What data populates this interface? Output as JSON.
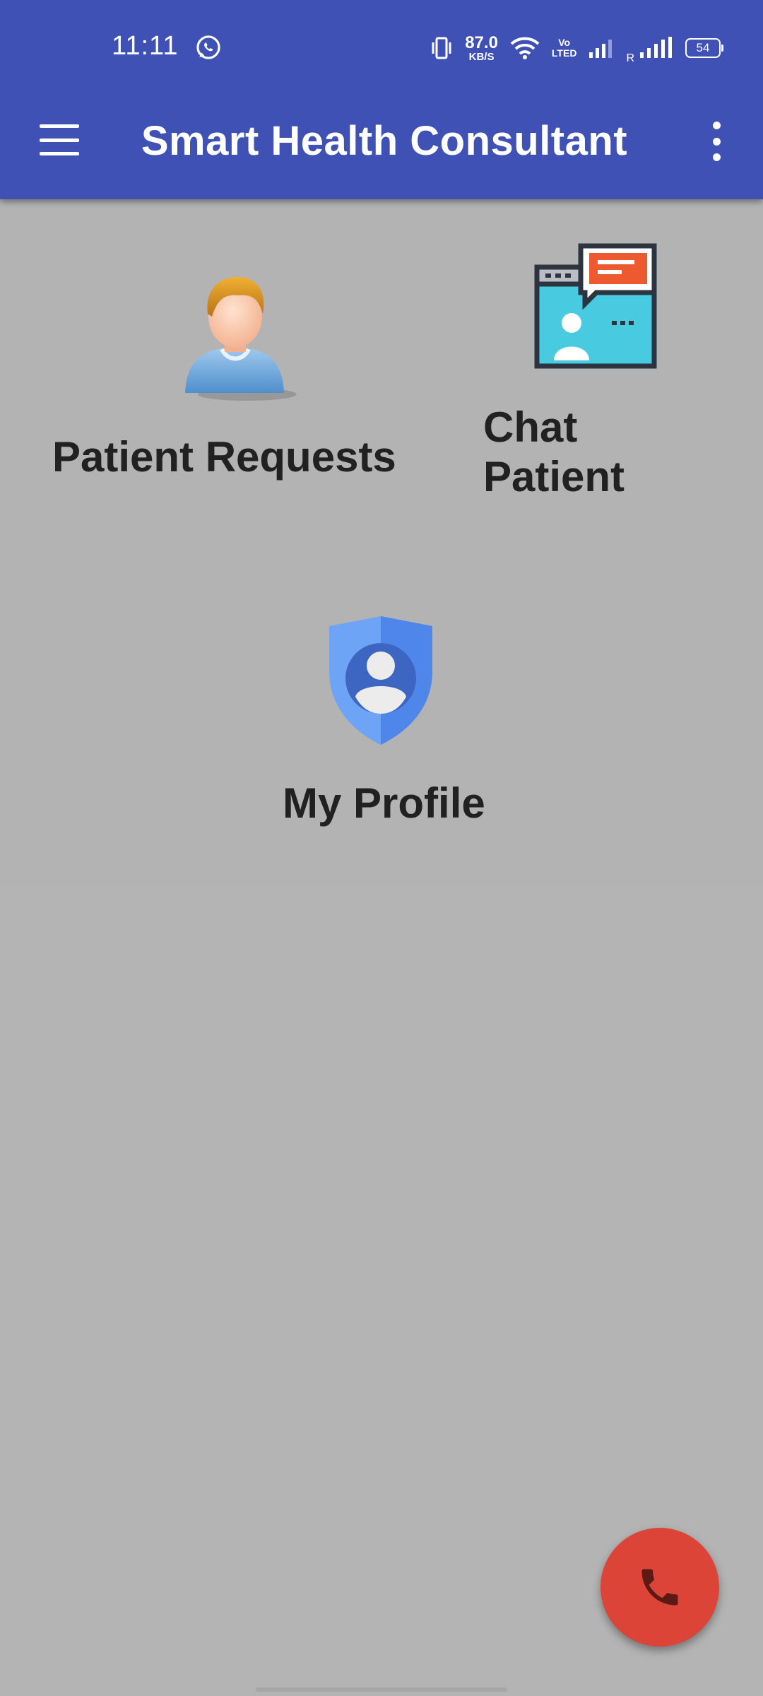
{
  "status_bar": {
    "time": "11:11",
    "network_speed_value": "87.0",
    "network_speed_unit": "KB/S",
    "volte_top": "Vo",
    "volte_bottom": "LTED",
    "roaming_label": "R",
    "battery_level": "54"
  },
  "toolbar": {
    "title": "Smart Health Consultant",
    "menu_icon": "hamburger-icon",
    "overflow_icon": "more-vert-icon"
  },
  "tiles": [
    {
      "label": "Patient Requests",
      "icon": "patient-person-icon"
    },
    {
      "label": "Chat Patient",
      "icon": "chat-window-icon"
    },
    {
      "label": "My Profile",
      "icon": "profile-shield-icon"
    }
  ],
  "fab": {
    "icon": "phone-icon"
  },
  "colors": {
    "appbar": "#3f51b5",
    "background": "#b4b4b4",
    "fab": "#db4437",
    "label_text": "#212121"
  }
}
